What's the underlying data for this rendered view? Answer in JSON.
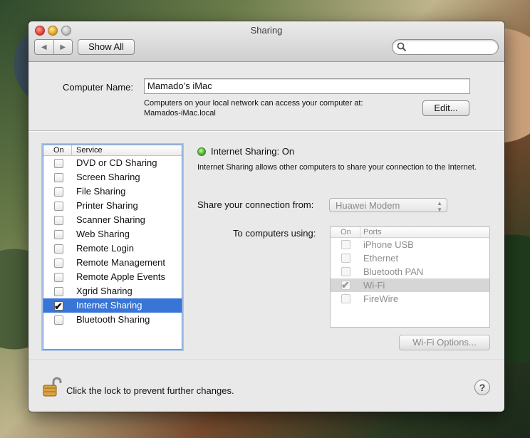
{
  "window": {
    "title": "Sharing"
  },
  "toolbar": {
    "show_all": "Show All",
    "search_placeholder": ""
  },
  "computer_name": {
    "label": "Computer Name:",
    "value": "Mamado’s iMac",
    "description_line1": "Computers on your local network can access your computer at:",
    "description_line2": "Mamados-iMac.local",
    "edit_button": "Edit..."
  },
  "services": {
    "header_on": "On",
    "header_service": "Service",
    "items": [
      {
        "label": "DVD or CD Sharing",
        "checked": false
      },
      {
        "label": "Screen Sharing",
        "checked": false
      },
      {
        "label": "File Sharing",
        "checked": false
      },
      {
        "label": "Printer Sharing",
        "checked": false
      },
      {
        "label": "Scanner Sharing",
        "checked": false
      },
      {
        "label": "Web Sharing",
        "checked": false
      },
      {
        "label": "Remote Login",
        "checked": false
      },
      {
        "label": "Remote Management",
        "checked": false
      },
      {
        "label": "Remote Apple Events",
        "checked": false
      },
      {
        "label": "Xgrid Sharing",
        "checked": false
      },
      {
        "label": "Internet Sharing",
        "checked": true
      },
      {
        "label": "Bluetooth Sharing",
        "checked": false
      }
    ]
  },
  "detail": {
    "status": "Internet Sharing: On",
    "status_color": "#43b02a",
    "description": "Internet Sharing allows other computers to share your connection to the Internet.",
    "share_from_label": "Share your connection from:",
    "share_from_value": "Huawei Modem",
    "to_computers_label": "To computers using:",
    "ports_header_on": "On",
    "ports_header_ports": "Ports",
    "ports": [
      {
        "label": "iPhone USB",
        "checked": false
      },
      {
        "label": "Ethernet",
        "checked": false
      },
      {
        "label": "Bluetooth PAN",
        "checked": false
      },
      {
        "label": "Wi-Fi",
        "checked": true
      },
      {
        "label": "FireWire",
        "checked": false
      }
    ],
    "wifi_options_button": "Wi-Fi Options..."
  },
  "footer": {
    "lock_text": "Click the lock to prevent further changes.",
    "help_label": "?"
  },
  "colors": {
    "selection": "#3875d7",
    "window_bg": "#e9e9e9"
  }
}
